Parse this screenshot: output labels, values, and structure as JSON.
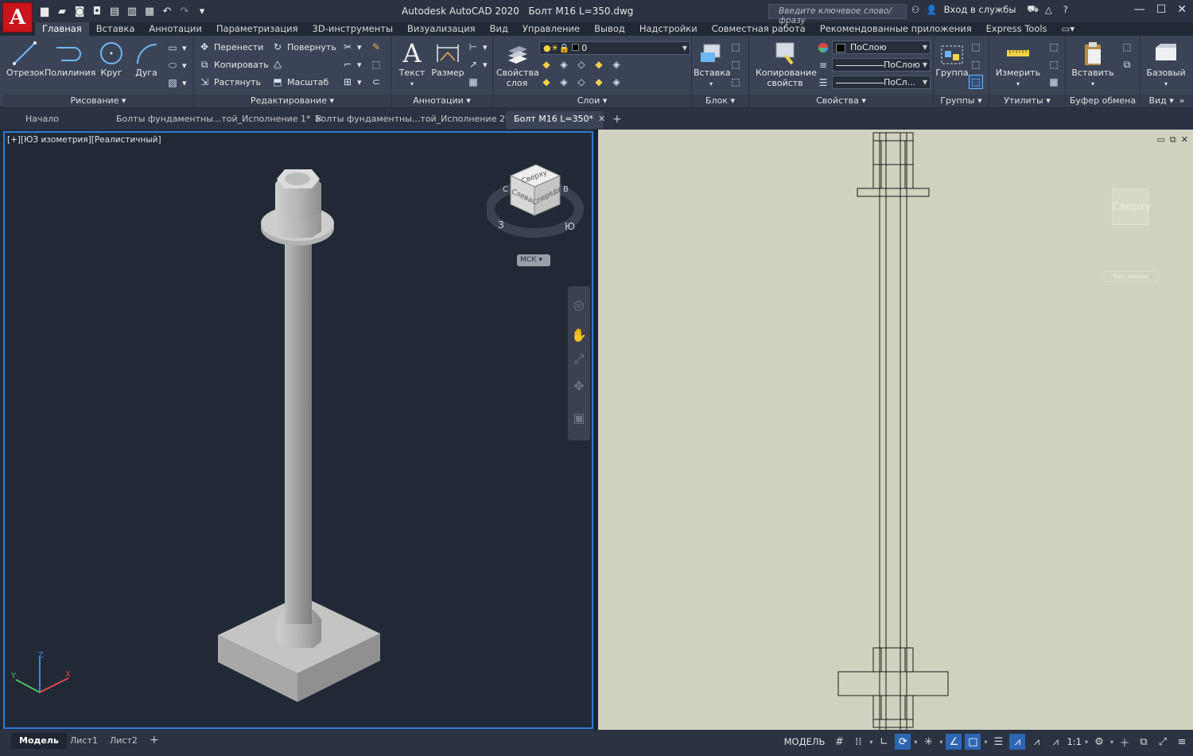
{
  "app": {
    "logo_letter": "A",
    "title": "Autodesk AutoCAD 2020",
    "filename": "Болт М16 L=350.dwg",
    "search_placeholder": "Введите ключевое слово/фразу",
    "signin_label": "Вход в службы"
  },
  "ribbon_tabs": [
    "Главная",
    "Вставка",
    "Аннотации",
    "Параметризация",
    "3D-инструменты",
    "Визуализация",
    "Вид",
    "Управление",
    "Вывод",
    "Надстройки",
    "Совместная работа",
    "Рекомендованные приложения",
    "Express Tools"
  ],
  "ribbon": {
    "draw": {
      "title": "Рисование",
      "line": "Отрезок",
      "polyline": "Полилиния",
      "circle": "Круг",
      "arc": "Дуга"
    },
    "modify": {
      "title": "Редактирование",
      "move": "Перенести",
      "rotate": "Повернуть",
      "copy": "Копировать",
      "stretch": "Растянуть",
      "scale": "Масштаб"
    },
    "annotation": {
      "title": "Аннотации",
      "text": "Текст",
      "dimension": "Размер"
    },
    "layers": {
      "title": "Слои",
      "layer_props_1": "Свойства",
      "layer_props_2": "слоя",
      "current_layer": "0"
    },
    "block": {
      "title": "Блок",
      "insert": "Вставка"
    },
    "properties": {
      "title": "Свойства",
      "match_1": "Копирование",
      "match_2": "свойств",
      "color": "ПоСлою",
      "linetype": "ПоСлою",
      "lineweight": "ПоСл..."
    },
    "groups": {
      "title": "Группы",
      "group": "Группа"
    },
    "utilities": {
      "title": "Утилиты",
      "measure": "Измерить"
    },
    "clipboard": {
      "title": "Буфер обмена",
      "paste": "Вставить"
    },
    "view": {
      "title": "Вид",
      "base": "Базовый"
    }
  },
  "doc_tabs": [
    {
      "label": "Начало"
    },
    {
      "label": "Болты фундаментны...той_Исполнение 1*"
    },
    {
      "label": "Болты фундаментны...той_Исполнение 2*"
    },
    {
      "label": "Болт М16 L=350*"
    }
  ],
  "viewport_left": {
    "label": "[+][ЮЗ изометрия][Реалистичный]",
    "viewcube_top": "Сверху",
    "viewcube_left": "Слева",
    "viewcube_front": "Спереди",
    "compass_w": "З",
    "compass_s": "Ю",
    "compass_n": "С",
    "compass_e": "В",
    "ucs_label": "МСК"
  },
  "viewport_right": {
    "viewcube_label": "Сверху",
    "ucs_label": "Без имени"
  },
  "layout_tabs": [
    "Модель",
    "Лист1",
    "Лист2"
  ],
  "status": {
    "model_label": "МОДЕЛЬ",
    "scale": "1:1"
  },
  "colors": {
    "accent": "#2f7bd6",
    "logo_red": "#c8141a",
    "paper": "#d1d1bf"
  }
}
